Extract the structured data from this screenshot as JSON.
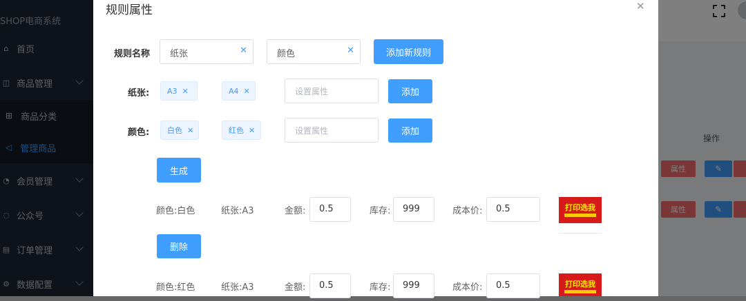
{
  "app": {
    "brand": "SHOP电商系统",
    "nav": [
      {
        "label": "首页",
        "icon": "home-icon"
      },
      {
        "label": "商品管理",
        "icon": "goods-icon"
      },
      {
        "label": "商品分类",
        "icon": "grid-icon"
      },
      {
        "label": "管理商品",
        "icon": "send-icon"
      },
      {
        "label": "会员管理",
        "icon": "user-icon"
      },
      {
        "label": "公众号",
        "icon": "chat-icon"
      },
      {
        "label": "订单管理",
        "icon": "order-icon"
      },
      {
        "label": "数据配置",
        "icon": "data-icon"
      }
    ],
    "table": {
      "op_header": "操作",
      "attr_label": "属性",
      "edit_icon": "pencil-icon"
    }
  },
  "dialog": {
    "title": "规则属性",
    "close_icon": "close-icon",
    "rule_name_label": "规则名称",
    "rule_inputs": [
      "纸张",
      "颜色"
    ],
    "add_rule_label": "添加新规则",
    "attributes": [
      {
        "label": "纸张:",
        "tags": [
          "A3",
          "A4"
        ],
        "placeholder": "设置属性",
        "add_label": "添加"
      },
      {
        "label": "颜色:",
        "tags": [
          "白色",
          "红色"
        ],
        "placeholder": "设置属性",
        "add_label": "添加"
      }
    ],
    "generate_label": "生成",
    "sku_fields": {
      "price_label": "金额:",
      "stock_label": "库存:",
      "cost_label": "成本价:"
    },
    "skus": [
      {
        "color": "颜色:白色",
        "paper": "纸张:A3",
        "price": "0.5",
        "stock": "999",
        "cost": "0.5",
        "image": "打印选我"
      },
      {
        "color": "颜色:红色",
        "paper": "纸张:A3",
        "price": "0.5",
        "stock": "999",
        "cost": "0.5",
        "image": "打印选我"
      }
    ],
    "delete_label": "删除"
  }
}
